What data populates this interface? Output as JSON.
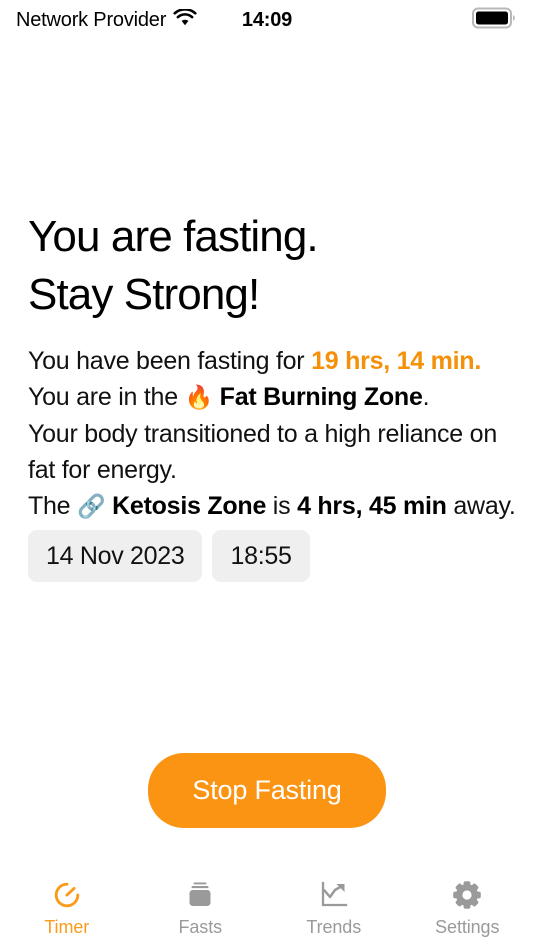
{
  "status_bar": {
    "carrier": "Network Provider",
    "wifi_icon": "wifi-icon",
    "time": "14:09",
    "battery_icon": "battery-full-icon"
  },
  "headline": {
    "line1": "You are fasting.",
    "line2": "Stay Strong!"
  },
  "body": {
    "l1_a": "You have been fasting for ",
    "l1_elapsed": "19 hrs, 14 min",
    "l1_b": ".",
    "l2_a": "You are in the ",
    "l2_emoji": "🔥",
    "l2_zone": "Fat Burning Zone",
    "l2_b": ".",
    "l3": "Your body transitioned to a high reliance on fat for energy.",
    "l4_a": "The ",
    "l4_emoji": "🔗",
    "l4_zone": "Ketosis Zone",
    "l4_b": " is ",
    "l4_remaining": "4 hrs, 45 min",
    "l4_c": " away."
  },
  "start_fields": {
    "date": "14 Nov 2023",
    "time": "18:55"
  },
  "cta": {
    "label": "Stop Fasting"
  },
  "tabs": [
    {
      "label": "Timer",
      "icon": "stopwatch-icon",
      "active": true
    },
    {
      "label": "Fasts",
      "icon": "stack-icon",
      "active": false
    },
    {
      "label": "Trends",
      "icon": "line-chart-icon",
      "active": false
    },
    {
      "label": "Settings",
      "icon": "gear-icon",
      "active": false
    }
  ],
  "colors": {
    "accent": "#F99C1C",
    "cta_background": "#FB9313",
    "chip_background": "#EFEFEF",
    "inactive_tab": "#9a9a9a"
  }
}
